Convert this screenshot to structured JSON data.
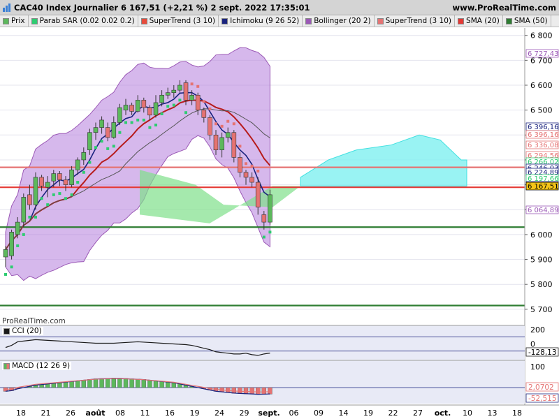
{
  "header": {
    "title": "CAC40 Index Journalier 6 167,51 (+2,21 %) 2 sept. 2022 17:35:01",
    "site": "www.ProRealTime.com"
  },
  "indicators": [
    {
      "label": "Prix",
      "color": "#5cb85c"
    },
    {
      "label": "Parab SAR (0.02 0.02 0.2)",
      "color": "#2ecc71"
    },
    {
      "label": "SuperTrend (3 10)",
      "color": "#e74c3c"
    },
    {
      "label": "Ichimoku (9 26 52)",
      "color": "#1a237e"
    },
    {
      "label": "Bollinger (20 2)",
      "color": "#9b59b6"
    },
    {
      "label": "SuperTrend (3 10)",
      "color": "#e57373"
    },
    {
      "label": "SMA (20)",
      "color": "#e53935"
    },
    {
      "label": "SMA (50)",
      "color": "#2e7d32"
    }
  ],
  "watermark": "ProRealTime.com",
  "cci": {
    "label": "CCI (20)",
    "value_label": "-128,13",
    "color": "#1a1a1a"
  },
  "macd": {
    "label": "MACD (12 26 9)",
    "value1": "2,0702",
    "value2": "-52,515",
    "color": "#e57373"
  },
  "price_axis": {
    "ticks": [
      "6 800",
      "6 700",
      "6 600",
      "6 500",
      "6 400",
      "6 300",
      "6 200",
      "6 100",
      "6 000",
      "5 900",
      "5 800",
      "5 700"
    ],
    "badges": [
      {
        "text": "6 727,43",
        "color": "#9b59b6",
        "bg": "#ffffff"
      },
      {
        "text": "6 396,16",
        "color": "#1a237e",
        "bg": "#ffffff"
      },
      {
        "text": "6 396,16",
        "color": "#e57373",
        "bg": "#ffffff"
      },
      {
        "text": "6 336,08",
        "color": "#e57373",
        "bg": "#ffffff"
      },
      {
        "text": "6 294,56",
        "color": "#e57373",
        "bg": "#ffffff"
      },
      {
        "text": "6 266,02",
        "color": "#2ecc71",
        "bg": "#ffffff"
      },
      {
        "text": "6 246,03",
        "color": "#1a237e",
        "bg": "#ffffff"
      },
      {
        "text": "6 224,89",
        "color": "#1a237e",
        "bg": "#ffffff"
      },
      {
        "text": "6 197,66",
        "color": "#2ecc71",
        "bg": "#ffffff"
      },
      {
        "text": "6 187,31",
        "color": "#1a237e",
        "bg": "#ffffff"
      },
      {
        "text": "6 167,51",
        "color": "#000000",
        "bg": "#f5c518"
      },
      {
        "text": "6 064,89",
        "color": "#9b59b6",
        "bg": "#ffffff"
      }
    ],
    "cci_ticks": [
      "200",
      "0"
    ],
    "macd_ticks": [
      "100"
    ]
  },
  "time_axis": [
    "18",
    "21",
    "26",
    "août",
    "08",
    "11",
    "16",
    "19",
    "24",
    "29",
    "sept.",
    "06",
    "09",
    "14",
    "19",
    "22",
    "27",
    "oct.",
    "10",
    "13",
    "18"
  ],
  "chart_data": {
    "type": "candlestick",
    "title": "CAC40 Index Journalier",
    "ylim": [
      5680,
      6830
    ],
    "candles": [
      [
        5910,
        5940,
        5870,
        5955
      ],
      [
        5915,
        6010,
        5900,
        6020
      ],
      [
        6000,
        6050,
        5985,
        6070
      ],
      [
        6050,
        6150,
        6030,
        6165
      ],
      [
        6160,
        6120,
        6100,
        6200
      ],
      [
        6120,
        6230,
        6100,
        6250
      ],
      [
        6230,
        6195,
        6175,
        6240
      ],
      [
        6190,
        6210,
        6150,
        6235
      ],
      [
        6215,
        6245,
        6190,
        6260
      ],
      [
        6245,
        6220,
        6195,
        6255
      ],
      [
        6220,
        6200,
        6175,
        6235
      ],
      [
        6200,
        6260,
        6190,
        6275
      ],
      [
        6260,
        6300,
        6240,
        6310
      ],
      [
        6300,
        6330,
        6280,
        6350
      ],
      [
        6340,
        6410,
        6320,
        6425
      ],
      [
        6410,
        6430,
        6380,
        6450
      ],
      [
        6430,
        6460,
        6405,
        6475
      ],
      [
        6430,
        6390,
        6375,
        6450
      ],
      [
        6390,
        6450,
        6385,
        6475
      ],
      [
        6450,
        6510,
        6440,
        6525
      ],
      [
        6500,
        6520,
        6480,
        6545
      ],
      [
        6520,
        6495,
        6480,
        6530
      ],
      [
        6495,
        6540,
        6490,
        6560
      ],
      [
        6540,
        6510,
        6490,
        6550
      ],
      [
        6510,
        6480,
        6460,
        6520
      ],
      [
        6480,
        6530,
        6470,
        6560
      ],
      [
        6530,
        6560,
        6515,
        6580
      ],
      [
        6560,
        6570,
        6545,
        6590
      ],
      [
        6570,
        6580,
        6550,
        6600
      ],
      [
        6580,
        6600,
        6570,
        6620
      ],
      [
        6610,
        6540,
        6520,
        6620
      ],
      [
        6540,
        6560,
        6520,
        6580
      ],
      [
        6560,
        6500,
        6480,
        6570
      ],
      [
        6500,
        6470,
        6450,
        6510
      ],
      [
        6470,
        6400,
        6380,
        6480
      ],
      [
        6400,
        6340,
        6320,
        6420
      ],
      [
        6340,
        6390,
        6310,
        6410
      ],
      [
        6390,
        6410,
        6370,
        6430
      ],
      [
        6410,
        6310,
        6290,
        6420
      ],
      [
        6310,
        6250,
        6230,
        6330
      ],
      [
        6250,
        6230,
        6200,
        6260
      ],
      [
        6230,
        6210,
        6190,
        6250
      ],
      [
        6210,
        6110,
        6080,
        6230
      ],
      [
        6080,
        6050,
        6020,
        6095
      ],
      [
        6050,
        6160,
        6040,
        6180
      ]
    ],
    "reference_lines": [
      {
        "value": 6190,
        "color": "#e53935",
        "name": "SMA (20)"
      },
      {
        "value": 6030,
        "color": "#2e7d32",
        "name": "SMA (50)"
      },
      {
        "value": 5715,
        "color": "#2e7d32",
        "name": "SMA (50)"
      },
      {
        "value": 6270,
        "color": "#e57373",
        "name": "SuperTrend (3 10)"
      }
    ],
    "cci_values": [
      -50,
      -20,
      30,
      40,
      50,
      60,
      55,
      50,
      45,
      40,
      35,
      30,
      25,
      20,
      15,
      10,
      10,
      10,
      10,
      15,
      20,
      25,
      30,
      25,
      20,
      15,
      10,
      5,
      0,
      -5,
      -10,
      -20,
      -40,
      -60,
      -80,
      -110,
      -120,
      -130,
      -140,
      -140,
      -130,
      -150,
      -160,
      -140,
      -128
    ],
    "macd_values": [
      -30,
      -25,
      -10,
      0,
      10,
      20,
      25,
      30,
      35,
      40,
      45,
      50,
      55,
      60,
      65,
      70,
      72,
      74,
      76,
      75,
      73,
      70,
      68,
      65,
      60,
      55,
      50,
      45,
      40,
      30,
      20,
      10,
      0,
      -10,
      -20,
      -30,
      -35,
      -40,
      -45,
      -48,
      -50,
      -52,
      -55,
      -54,
      -52
    ]
  }
}
